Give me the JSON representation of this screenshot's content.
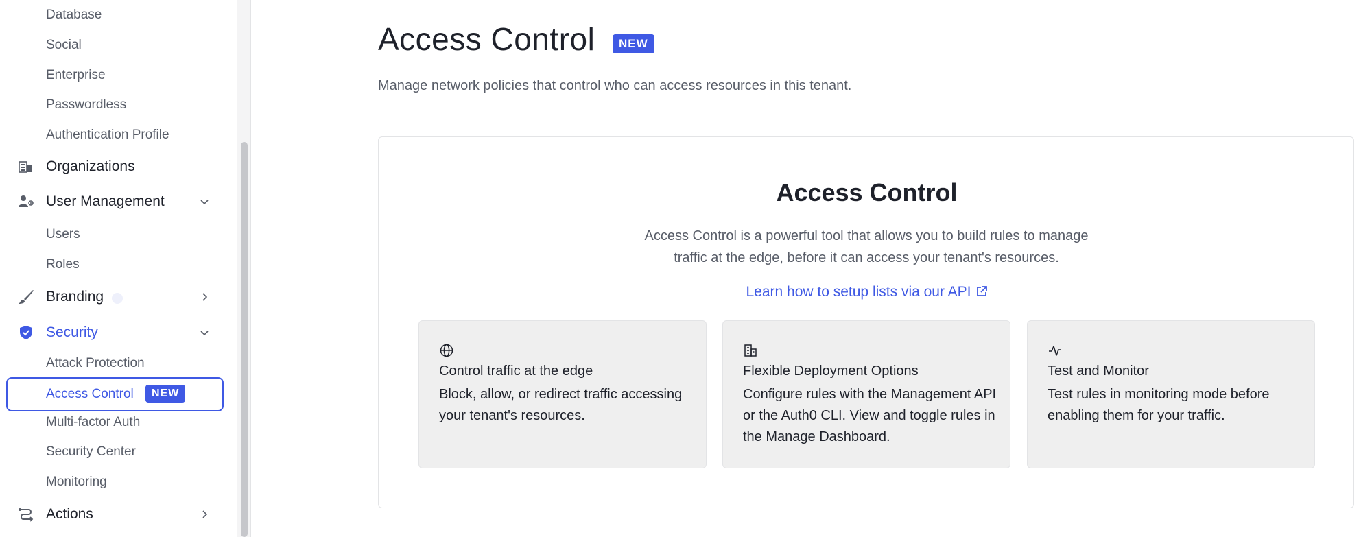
{
  "sidebar": {
    "sub_items_top": [
      "Database",
      "Social",
      "Enterprise",
      "Passwordless",
      "Authentication Profile"
    ],
    "organizations": {
      "label": "Organizations",
      "icon": "building-icon"
    },
    "user_management": {
      "label": "User Management",
      "icon": "user-gear-icon",
      "children": [
        "Users",
        "Roles"
      ]
    },
    "branding": {
      "label": "Branding",
      "icon": "brush-icon"
    },
    "security": {
      "label": "Security",
      "icon": "shield-check-icon",
      "children": [
        "Attack Protection",
        "Access Control",
        "Multi-factor Auth",
        "Security Center",
        "Monitoring"
      ],
      "active_child": "Access Control",
      "active_badge": "NEW"
    },
    "actions": {
      "label": "Actions",
      "icon": "actions-flow-icon"
    }
  },
  "main": {
    "title": "Access Control",
    "title_badge": "NEW",
    "description": "Manage network policies that control who can access resources in this tenant.",
    "card": {
      "title": "Access Control",
      "description": "Access Control is a powerful tool that allows you to build rules to manage traffic at the edge, before it can access your tenant's resources.",
      "link": "Learn how to setup lists via our API",
      "features": [
        {
          "icon": "globe-icon",
          "title": "Control traffic at the edge",
          "description": "Block, allow, or redirect traffic accessing your tenant's resources."
        },
        {
          "icon": "buildings-icon",
          "title": "Flexible Deployment Options",
          "description": "Configure rules with the Management API or the Auth0 CLI. View and toggle rules in the Manage Dashboard."
        },
        {
          "icon": "activity-icon",
          "title": "Test and Monitor",
          "description": "Test rules in monitoring mode before enabling them for your traffic."
        }
      ]
    }
  },
  "colors": {
    "accent": "#3f59e4",
    "text": "#1e212a",
    "muted": "#585d68",
    "feature_bg": "#efefef",
    "border": "#e3e4e6"
  }
}
